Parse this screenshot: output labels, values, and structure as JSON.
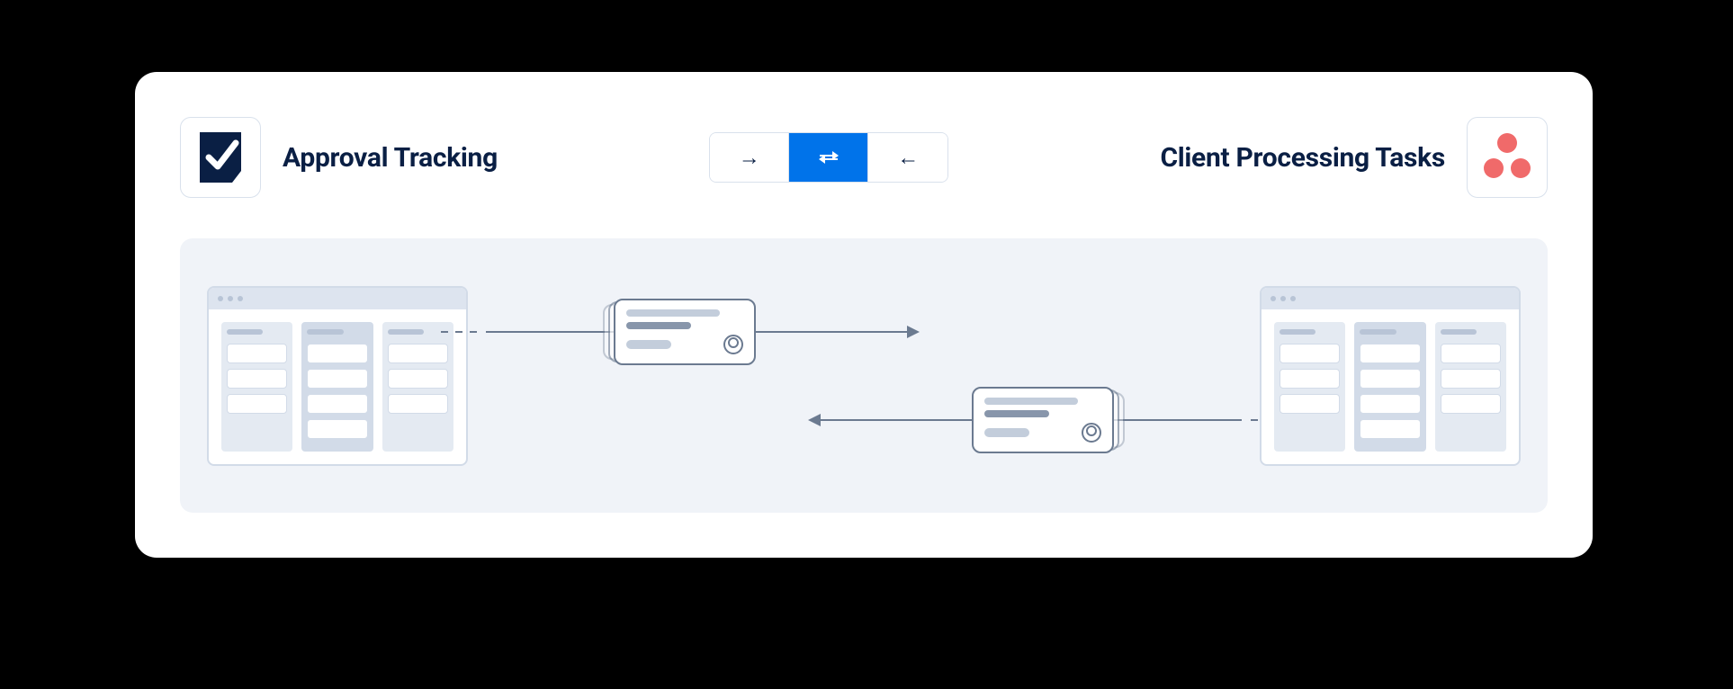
{
  "left": {
    "app_name": "Smartsheet",
    "title": "Approval Tracking"
  },
  "right": {
    "app_name": "Asana",
    "title": "Client Processing Tasks"
  },
  "sync": {
    "options": [
      "one-way-right",
      "two-way",
      "one-way-left"
    ],
    "selected": "two-way"
  },
  "colors": {
    "accent": "#0073ea",
    "asana": "#f06a6a",
    "smartsheet": "#0a1f44"
  }
}
